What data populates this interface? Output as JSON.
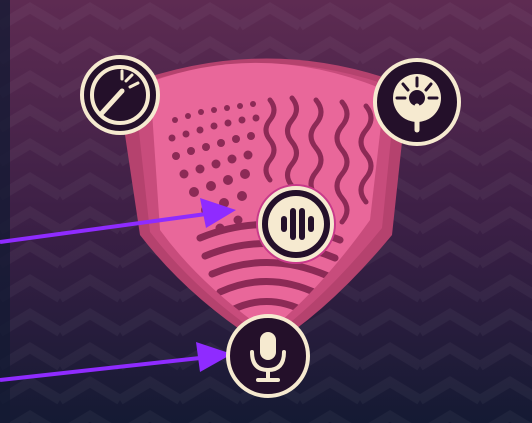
{
  "colors": {
    "background_top": "#5e2b52",
    "background_bottom": "#141a33",
    "shield_outer": "#b5426e",
    "shield_mid": "#d35585",
    "shield_inner": "#e9679a",
    "pattern": "#8c2a56",
    "node_fill": "#24102a",
    "node_border": "#f6ead0",
    "icon": "#f6ead0",
    "arrow": "#8f2bff"
  },
  "nodes": [
    {
      "id": "left",
      "icon": "drum-icon"
    },
    {
      "id": "right",
      "icon": "gong-icon"
    },
    {
      "id": "center",
      "icon": "sound-wave-icon"
    },
    {
      "id": "bottom",
      "icon": "microphone-icon"
    }
  ],
  "arrows": [
    {
      "from": "off-screen-left",
      "to": "sound-wave-node"
    },
    {
      "from": "off-screen-left",
      "to": "microphone-node"
    }
  ]
}
